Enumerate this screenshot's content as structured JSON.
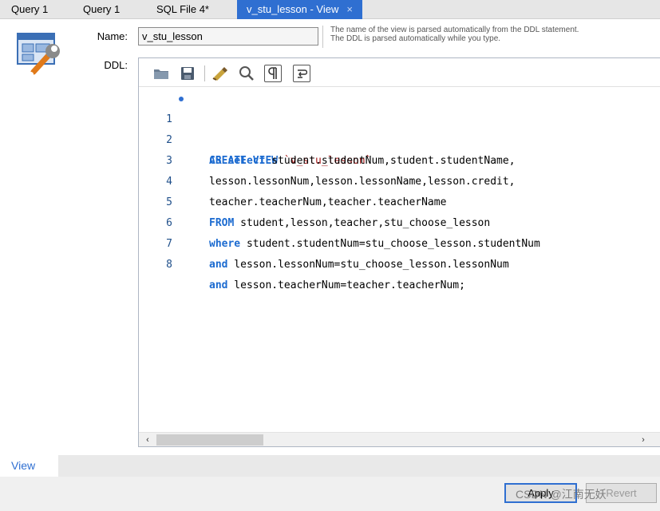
{
  "tabs": [
    {
      "label": "Query 1"
    },
    {
      "label": "Query 1"
    },
    {
      "label": "SQL File 4*"
    },
    {
      "label": "v_stu_lesson - View",
      "close": "×"
    }
  ],
  "form": {
    "name_label": "Name:",
    "name_value": "v_stu_lesson",
    "hint": "The name of the view is parsed automatically from the DDL statement. The DDL is parsed automatically while you type.",
    "ddl_label": "DDL:"
  },
  "toolbar_icons": [
    "folder-open-icon",
    "save-icon",
    "beautify-brush-icon",
    "search-replace-icon",
    "toggle-invisible-chars-icon",
    "word-wrap-icon"
  ],
  "code": {
    "lines": [
      {
        "num": "1",
        "kw": "CREATE VIEW",
        "text": " ",
        "str": "`v_stu_lesson`"
      },
      {
        "num": "2",
        "kw": "AS select",
        "text": " student.studentNum,student.studentName,"
      },
      {
        "num": "3",
        "kw": "",
        "text": "lesson.lessonNum,lesson.lessonName,lesson.credit,"
      },
      {
        "num": "4",
        "kw": "",
        "text": "teacher.teacherNum,teacher.teacherName"
      },
      {
        "num": "5",
        "kw": "FROM",
        "text": " student,lesson,teacher,stu_choose_lesson"
      },
      {
        "num": "6",
        "kw": "where",
        "text": " student.studentNum=stu_choose_lesson.studentNum"
      },
      {
        "num": "7",
        "kw": "and",
        "text": " lesson.lessonNum=stu_choose_lesson.lessonNum"
      },
      {
        "num": "8",
        "kw": "and",
        "text": " lesson.teacherNum=teacher.teacherNum;"
      }
    ]
  },
  "scroll": {
    "left": "‹",
    "right": "›"
  },
  "bottom_tab": "View",
  "buttons": {
    "apply": "Apply",
    "revert": "Revert"
  },
  "watermark": "CSDN @江南无妖",
  "colors": {
    "accent": "#2f6fd1",
    "keyword": "#1c6bd0",
    "string": "#a31515"
  }
}
